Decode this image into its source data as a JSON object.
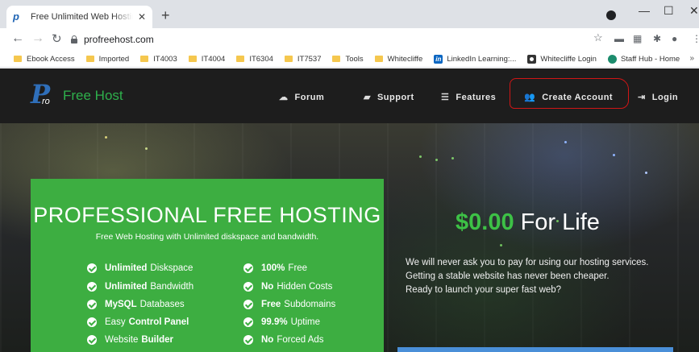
{
  "browser": {
    "tab_title": "Free Unlimited Web Hosting with",
    "tab_close": "✕",
    "new_tab": "+",
    "url": "profreehost.com",
    "window": {
      "minimize": "—",
      "maximize": "☐",
      "close": "✕"
    }
  },
  "bookmarks": [
    {
      "label": "Ebook Access",
      "icon": "folder-icon"
    },
    {
      "label": "Imported",
      "icon": "folder-icon"
    },
    {
      "label": "IT4003",
      "icon": "folder-icon"
    },
    {
      "label": "IT4004",
      "icon": "folder-icon"
    },
    {
      "label": "IT6304",
      "icon": "folder-icon"
    },
    {
      "label": "IT7537",
      "icon": "folder-icon"
    },
    {
      "label": "Tools",
      "icon": "folder-icon"
    },
    {
      "label": "Whitecliffe",
      "icon": "folder-icon"
    },
    {
      "label": "LinkedIn Learning:...",
      "icon": "linkedin-icon"
    },
    {
      "label": "Whitecliffe Login",
      "icon": "whitecliffe-icon"
    },
    {
      "label": "Staff Hub - Home",
      "icon": "staffhub-icon"
    }
  ],
  "site": {
    "logo_text": "Free Host",
    "logo_sub": "ro",
    "nav": {
      "forum": "Forum",
      "support": "Support",
      "features": "Features",
      "create_account": "Create Account",
      "login": "Login"
    },
    "hero": {
      "title": "PROFESSIONAL FREE HOSTING",
      "subtitle": "Free Web Hosting with Unlimited diskspace and bandwidth.",
      "features_left": [
        {
          "bold": "Unlimited",
          "text": "Diskspace"
        },
        {
          "bold": "Unlimited",
          "text": "Bandwidth"
        },
        {
          "bold": "MySQL",
          "text": "Databases"
        },
        {
          "pre": "Easy",
          "bold": "Control Panel",
          "text": ""
        },
        {
          "pre": "Website",
          "bold": "Builder",
          "text": ""
        }
      ],
      "features_right": [
        {
          "bold": "100%",
          "text": "Free"
        },
        {
          "bold": "No",
          "text": "Hidden Costs"
        },
        {
          "bold": "Free",
          "text": "Subdomains"
        },
        {
          "bold": "99.9%",
          "text": "Uptime"
        },
        {
          "bold": "No",
          "text": "Forced Ads"
        }
      ],
      "price_amount": "$0.00",
      "price_suffix": "For Life",
      "tagline_1": "We will never ask you to pay for using our hosting services.",
      "tagline_2": "Getting a stable website has never been cheaper.",
      "tagline_3": "Ready to launch your super fast web?"
    }
  },
  "colors": {
    "accent_green": "#3dae41",
    "price_green": "#3dc146",
    "highlight_red": "#d01616",
    "logo_blue": "#2f6fba"
  }
}
